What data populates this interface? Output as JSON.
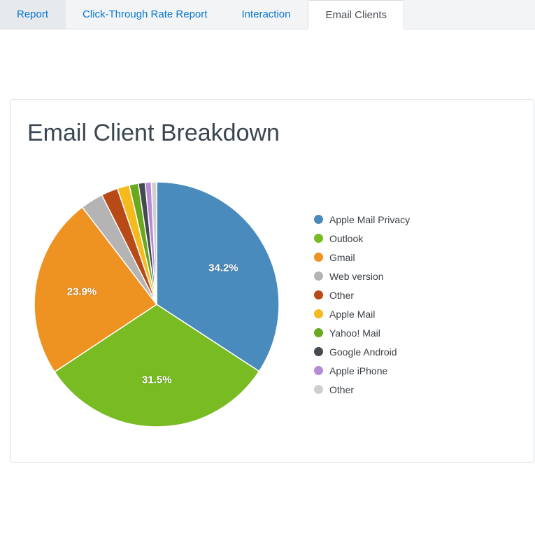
{
  "tabs": [
    {
      "label": "Report",
      "active": false,
      "first": true
    },
    {
      "label": "Click-Through Rate Report",
      "active": false,
      "first": false
    },
    {
      "label": "Interaction",
      "active": false,
      "first": false
    },
    {
      "label": "Email Clients",
      "active": true,
      "first": false
    }
  ],
  "panel": {
    "title": "Email Client Breakdown"
  },
  "chart_data": {
    "type": "pie",
    "title": "Email Client Breakdown",
    "series": [
      {
        "name": "Apple Mail Privacy",
        "value": 34.2,
        "color": "#4a8bbd",
        "show_label": true
      },
      {
        "name": "Outlook",
        "value": 31.5,
        "color": "#78bb22",
        "show_label": true
      },
      {
        "name": "Gmail",
        "value": 23.9,
        "color": "#ee9222",
        "show_label": true
      },
      {
        "name": "Web version",
        "value": 3.0,
        "color": "#b4b4b4",
        "show_label": false
      },
      {
        "name": "Other",
        "value": 2.2,
        "color": "#b84a17",
        "show_label": false
      },
      {
        "name": "Apple Mail",
        "value": 1.6,
        "color": "#f4bb1f",
        "show_label": false
      },
      {
        "name": "Yahoo! Mail",
        "value": 1.2,
        "color": "#69a81f",
        "show_label": false
      },
      {
        "name": "Google Android",
        "value": 0.9,
        "color": "#444a4f",
        "show_label": false
      },
      {
        "name": "Apple iPhone",
        "value": 0.8,
        "color": "#b78bd6",
        "show_label": false
      },
      {
        "name": "Other",
        "value": 0.7,
        "color": "#cfcfcf",
        "show_label": false
      }
    ]
  }
}
